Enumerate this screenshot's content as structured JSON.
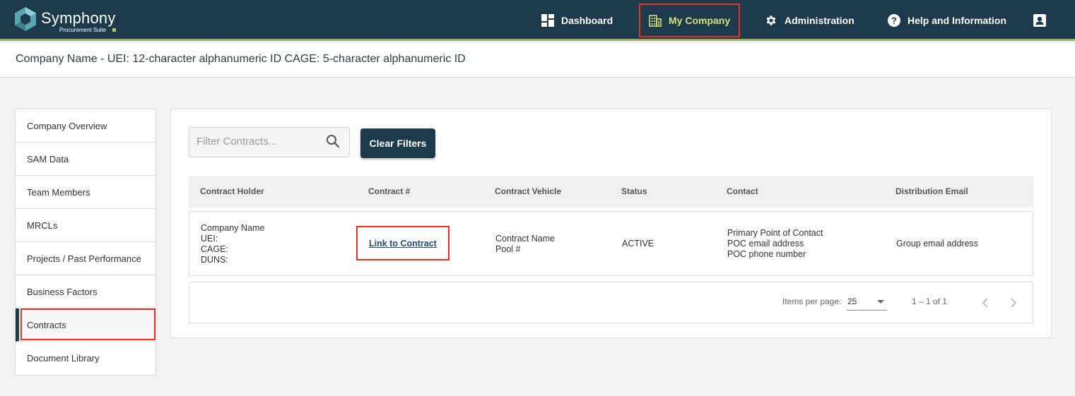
{
  "brand": {
    "name": "Symphony",
    "tagline": "Procurement Suite",
    "accent": "#b4c956",
    "nav_bg": "#1d3a4c"
  },
  "nav": {
    "dashboard": "Dashboard",
    "my_company": "My Company",
    "administration": "Administration",
    "help": "Help and Information",
    "icons": {
      "dashboard": "grid-icon",
      "my_company": "building-icon",
      "administration": "gear-icon",
      "help": "help-icon",
      "profile": "person-icon"
    }
  },
  "subheader": {
    "title": "Company Name - UEI: 12-character alphanumeric ID CAGE: 5-character alphanumeric ID"
  },
  "sidebar": {
    "items": [
      {
        "label": "Company Overview"
      },
      {
        "label": "SAM Data"
      },
      {
        "label": "Team Members"
      },
      {
        "label": "MRCLs"
      },
      {
        "label": "Projects / Past Performance"
      },
      {
        "label": "Business Factors"
      },
      {
        "label": "Contracts"
      },
      {
        "label": "Document Library"
      }
    ]
  },
  "filter": {
    "placeholder": "Filter Contracts...",
    "clear_label": "Clear Filters"
  },
  "table": {
    "headers": [
      "Contract Holder",
      "Contract #",
      "Contract Vehicle",
      "Status",
      "Contact",
      "Distribution Email"
    ],
    "row": {
      "holder": [
        "Company Name",
        "UEI:",
        "CAGE:",
        "DUNS:"
      ],
      "contract_link": "Link to Contract",
      "vehicle": [
        "Contract Name",
        "Pool #"
      ],
      "status": "ACTIVE",
      "contact": [
        "Primary Point of Contact",
        "POC email address",
        "POC phone number"
      ],
      "email": "Group email address"
    }
  },
  "paginator": {
    "items_per_page_label": "Items per page:",
    "items_per_page": "25",
    "range": "1 – 1 of 1"
  },
  "highlight_color": "#e8321f"
}
